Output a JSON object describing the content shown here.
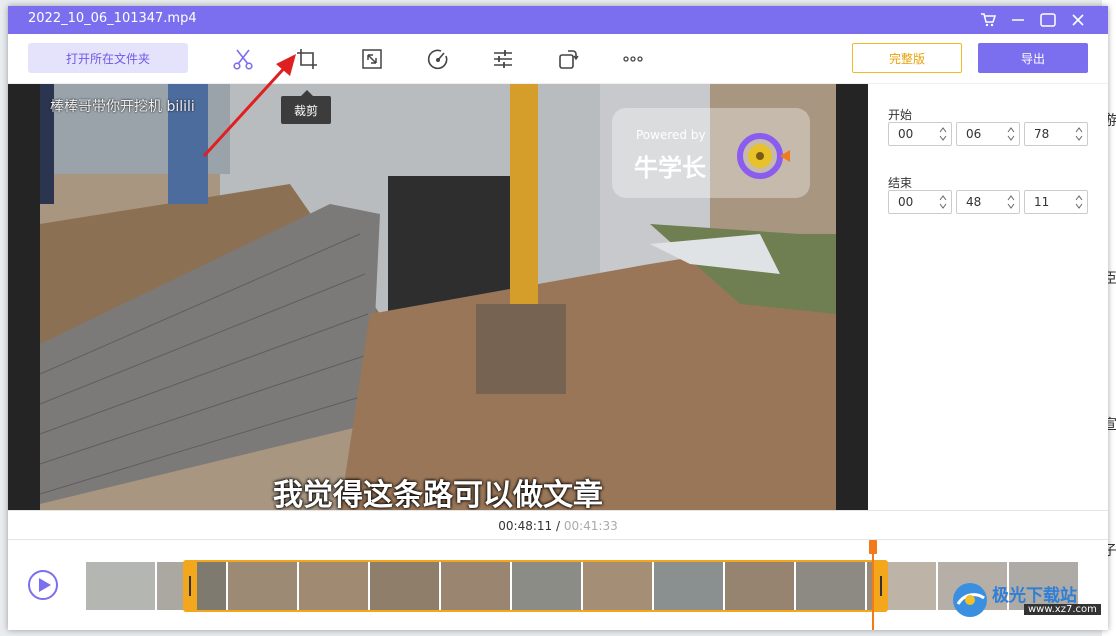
{
  "window": {
    "title": "2022_10_06_101347.mp4",
    "controls": [
      "cart-icon",
      "minimize-icon",
      "maximize-icon",
      "close-icon"
    ]
  },
  "toolbar": {
    "open_folder_label": "打开所在文件夹",
    "tools": [
      "scissors-icon",
      "crop-icon",
      "resize-icon",
      "speed-icon",
      "adjust-icon",
      "rotate-icon",
      "more-icon"
    ],
    "crop_tooltip": "裁剪",
    "full_version_label": "完整版",
    "export_label": "导出"
  },
  "video": {
    "subtitle": "我觉得这条路可以做文章",
    "overlay_text": "棒棒哥带你开挖机 bilili",
    "watermark_powered": "Powered by",
    "watermark_brand": "牛学长"
  },
  "side": {
    "start_label": "开始",
    "start": {
      "h": "00",
      "m": "06",
      "s": "78"
    },
    "end_label": "结束",
    "end": {
      "h": "00",
      "m": "48",
      "s": "11"
    }
  },
  "timeline": {
    "current": "00:48:11",
    "separator": " / ",
    "total": "00:41:33"
  },
  "site_watermark": {
    "text": "极光下载站",
    "sub": "www.xz7.com"
  },
  "colors": {
    "accent": "#7b6ff0",
    "handle": "#f2a71c",
    "playhead": "#f27a1c",
    "full_version": "#e8a20a"
  }
}
